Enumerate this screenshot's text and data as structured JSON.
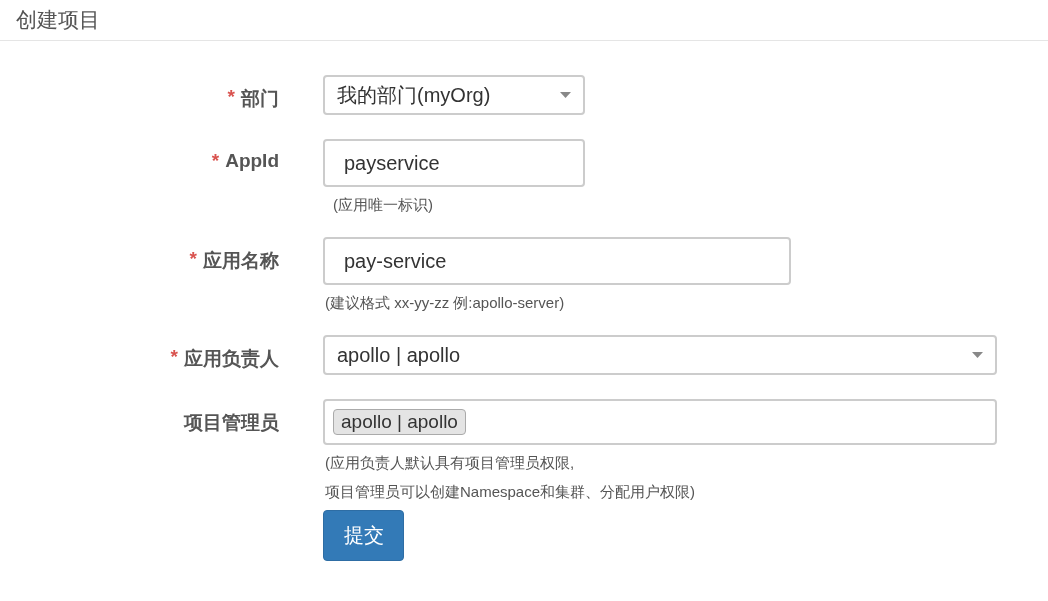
{
  "page_title": "创建项目",
  "fields": [
    {
      "kind": "select",
      "required_mark": "*",
      "label": "部门",
      "value": "我的部门(myOrg)"
    },
    {
      "kind": "input",
      "required_mark": "*",
      "label": "AppId",
      "value": "payservice",
      "hints": [
        "(应用唯一标识)"
      ]
    },
    {
      "kind": "input",
      "required_mark": "*",
      "label": "应用名称",
      "value": "pay-service",
      "hints": [
        "(建议格式 xx-yy-zz 例:apollo-server)"
      ]
    },
    {
      "kind": "select",
      "required_mark": "*",
      "label": "应用负责人",
      "value": "apollo | apollo"
    },
    {
      "kind": "tags",
      "label": "项目管理员",
      "tags": [
        "apollo | apollo"
      ],
      "hints": [
        "(应用负责人默认具有项目管理员权限,",
        "项目管理员可以创建Namespace和集群、分配用户权限)"
      ]
    }
  ],
  "submit": {
    "label": "提交"
  }
}
